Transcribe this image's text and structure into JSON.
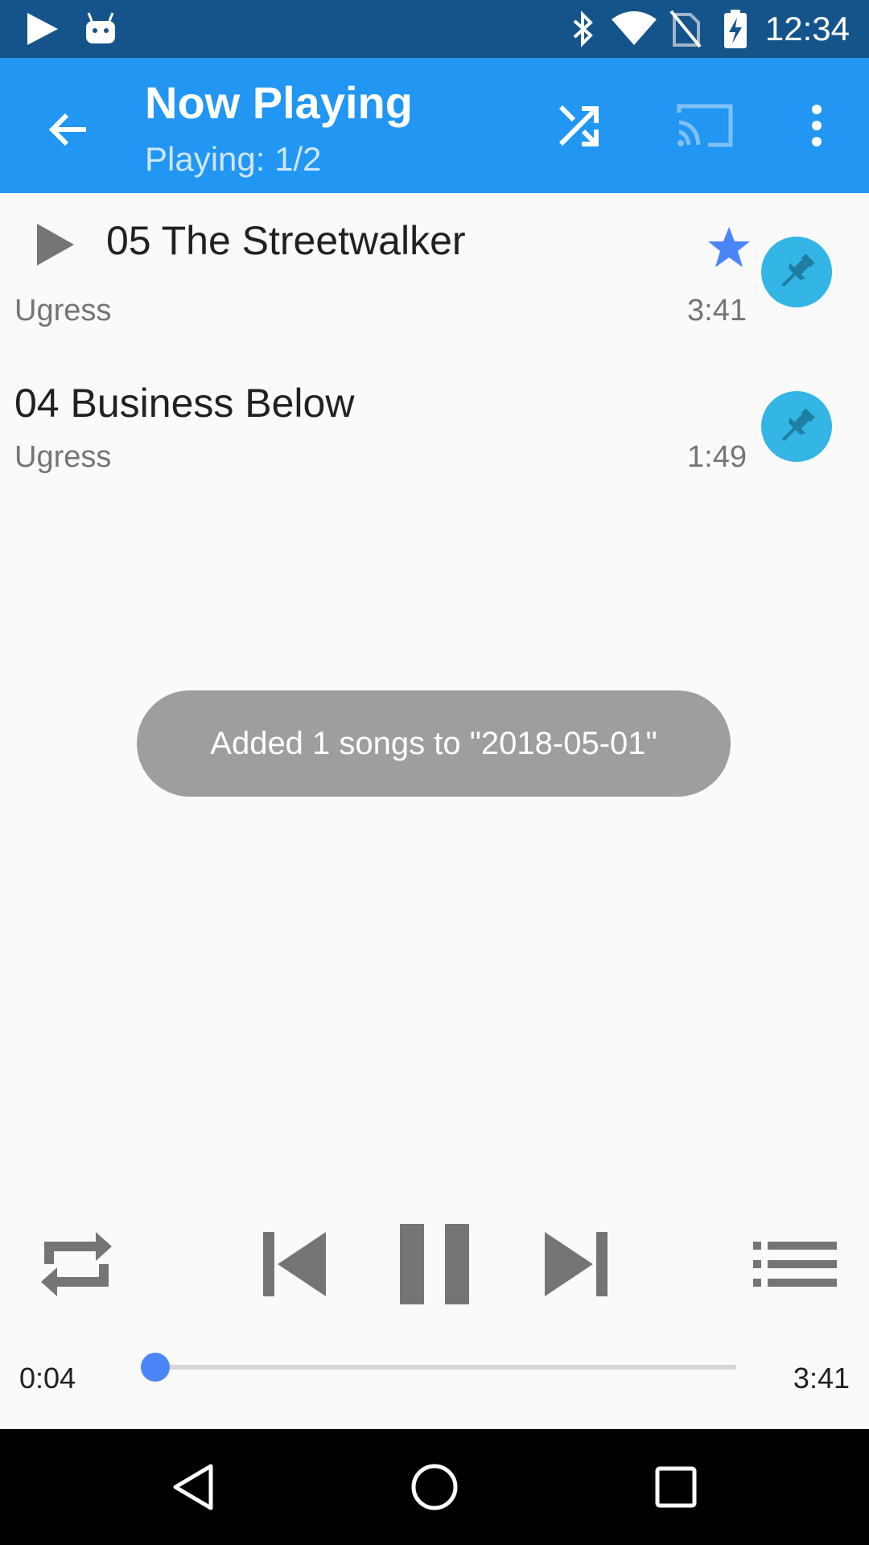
{
  "status_bar": {
    "time": "12:34",
    "icons": [
      "play-store-icon",
      "android-icon",
      "bluetooth-icon",
      "wifi-icon",
      "no-sim-icon",
      "battery-charging-icon"
    ]
  },
  "app_bar": {
    "title": "Now Playing",
    "subtitle": "Playing: 1/2",
    "icons": [
      "back-arrow-icon",
      "shuffle-icon",
      "cast-icon",
      "more-vert-icon"
    ]
  },
  "songs": [
    {
      "title": "05 The Streetwalker",
      "artist": "Ugress",
      "duration": "3:41",
      "playing": true,
      "starred": true
    },
    {
      "title": "04 Business Below",
      "artist": "Ugress",
      "duration": "1:49",
      "playing": false,
      "starred": false
    }
  ],
  "toast": {
    "text": "Added 1 songs to \"2018-05-01\""
  },
  "controls": {
    "icons": [
      "repeat-icon",
      "skip-previous-icon",
      "pause-icon",
      "skip-next-icon",
      "queue-list-icon"
    ]
  },
  "seek": {
    "elapsed": "0:04",
    "total": "3:41",
    "progress": 0.018
  },
  "nav_bar": {
    "icons": [
      "back-triangle-icon",
      "home-circle-icon",
      "recents-square-icon"
    ]
  },
  "colors": {
    "status_bar": "#15548a",
    "app_bar": "#2196f3",
    "accent": "#4a86f7",
    "pin_button": "#33b5e5",
    "star": "#4a86f7"
  }
}
